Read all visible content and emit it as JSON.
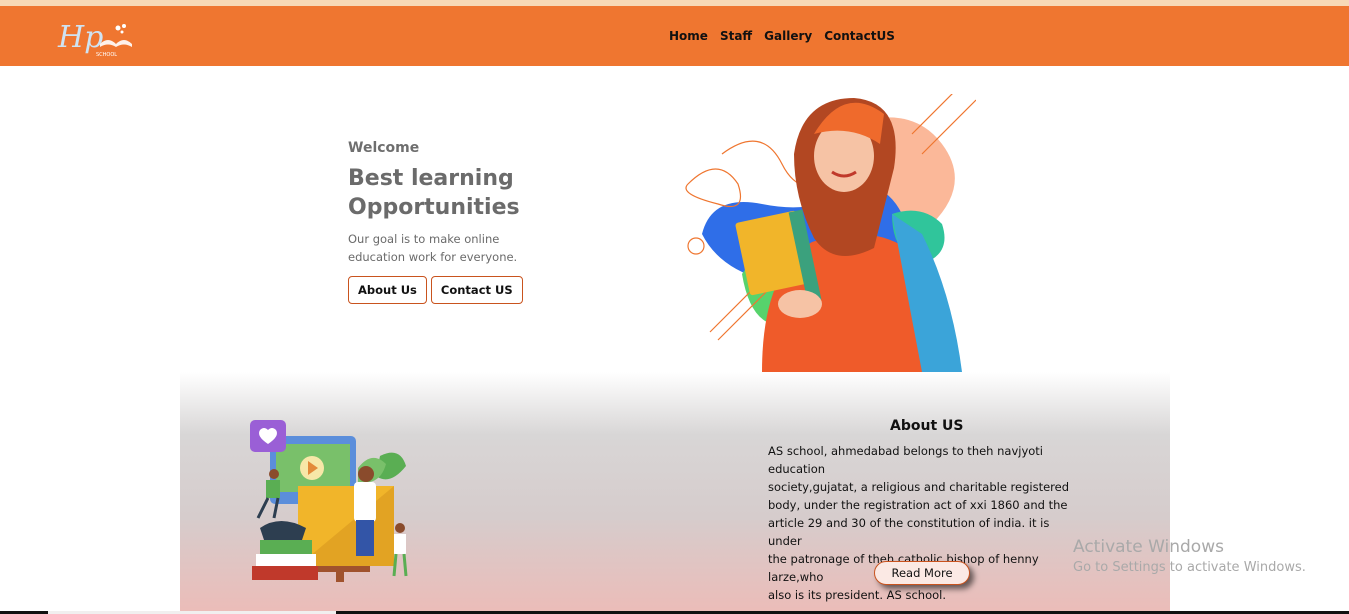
{
  "logo": {
    "text": "Hp",
    "subtext": "SCHOOL"
  },
  "nav": {
    "items": [
      "Home",
      "Staff",
      "Gallery",
      "ContactUS"
    ]
  },
  "hero": {
    "welcome": "Welcome",
    "headline": "Best learning Opportunities",
    "tagline": "Our goal is to make online education work for everyone.",
    "about_button": "About Us",
    "contact_button": "Contact US"
  },
  "about": {
    "title": "About US",
    "lines": [
      "AS school, ahmedabad belongs to theh navjyoti education",
      "society,gujatat, a religious and charitable registered",
      "body, under the registration act of xxi 1860 and the",
      "article 29 and 30 of the constitution of india. it is under",
      "the patronage of theh catholic bishop of henny larze,who",
      "also is its president. AS school."
    ],
    "read_more": "Read More"
  },
  "watermark": {
    "title": "Activate Windows",
    "subtitle": "Go to Settings to activate Windows."
  },
  "colors": {
    "brand_orange": "#ef7630",
    "button_border": "#c9531e"
  }
}
